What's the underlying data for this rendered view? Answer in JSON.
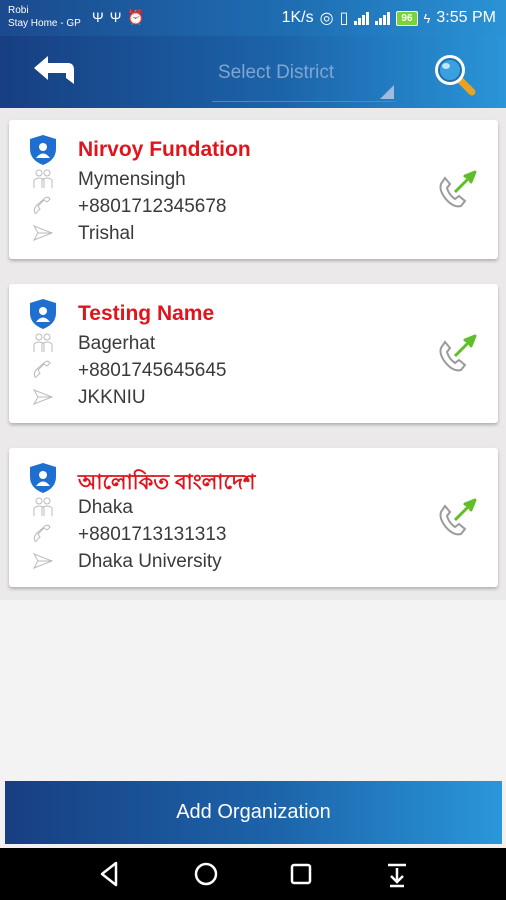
{
  "status_bar": {
    "carrier1": "Robi",
    "carrier2": "Stay Home - GP",
    "speed": "1K/s",
    "battery": "96",
    "time": "3:55 PM"
  },
  "appbar": {
    "district_placeholder": "Select District"
  },
  "organizations": [
    {
      "name": "Nirvoy Fundation",
      "district": "Mymensingh",
      "phone": "+8801712345678",
      "address": "Trishal"
    },
    {
      "name": "Testing Name",
      "district": "Bagerhat",
      "phone": "+8801745645645",
      "address": "JKKNIU"
    },
    {
      "name": "আলোকিত বাংলাদেশ",
      "district": "Dhaka",
      "phone": "+8801713131313",
      "address": "Dhaka University"
    }
  ],
  "add_button_label": "Add Organization",
  "colors": {
    "accent_dark": "#173f82",
    "accent_light": "#2a95d8",
    "name_red": "#e0141c",
    "call_green": "#5fbf2a"
  },
  "icons": [
    "back-arrow-icon",
    "search-icon",
    "shield-user-icon",
    "people-icon",
    "phone-icon",
    "send-icon",
    "call-icon"
  ]
}
